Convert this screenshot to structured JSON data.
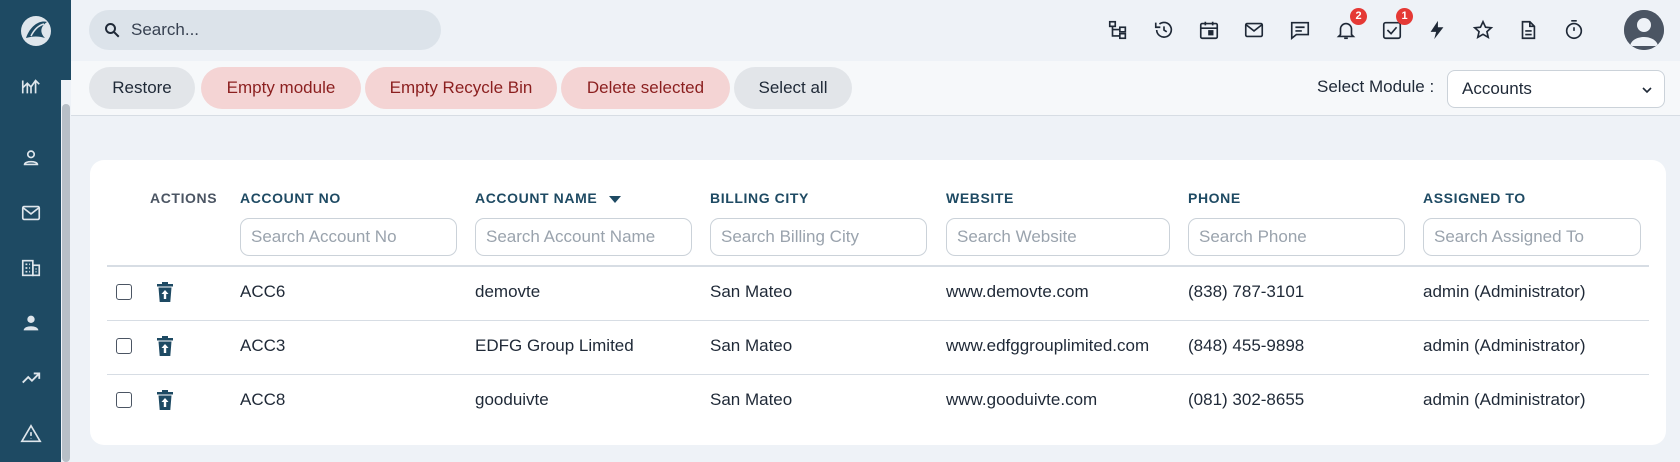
{
  "search": {
    "placeholder": "Search..."
  },
  "header": {
    "notifications_count": "2",
    "tasks_count": "1"
  },
  "toolbar": {
    "restore": "Restore",
    "empty_module": "Empty module",
    "empty_recycle_bin": "Empty Recycle Bin",
    "delete_selected": "Delete selected",
    "select_all": "Select all",
    "module_label": "Select Module :",
    "module_value": "Accounts"
  },
  "table": {
    "columns": {
      "actions": "ACTIONS",
      "account_no": "ACCOUNT NO",
      "account_name": "ACCOUNT NAME",
      "billing_city": "BILLING CITY",
      "website": "WEBSITE",
      "phone": "PHONE",
      "assigned_to": "ASSIGNED TO"
    },
    "filters": {
      "account_no": "Search Account No",
      "account_name": "Search Account Name",
      "billing_city": "Search Billing City",
      "website": "Search Website",
      "phone": "Search Phone",
      "assigned_to": "Search Assigned To"
    },
    "rows": [
      {
        "account_no": "ACC6",
        "account_name": "demovte",
        "billing_city": "San Mateo",
        "website": "www.demovte.com",
        "phone": "(838) 787-3101",
        "assigned_to": "admin (Administrator)"
      },
      {
        "account_no": "ACC3",
        "account_name": "EDFG Group Limited",
        "billing_city": "San Mateo",
        "website": "www.edfggrouplimited.com",
        "phone": "(848) 455-9898",
        "assigned_to": "admin (Administrator)"
      },
      {
        "account_no": "ACC8",
        "account_name": "gooduivte",
        "billing_city": "San Mateo",
        "website": "www.gooduivte.com",
        "phone": "(081) 302-8655",
        "assigned_to": "admin (Administrator)"
      }
    ]
  },
  "icons": {
    "sidebar": [
      "logo-icon",
      "analytics-icon",
      "contacts-icon",
      "mail-icon",
      "building-icon",
      "person-icon",
      "trend-icon",
      "warning-icon"
    ],
    "topbar": [
      "hierarchy-icon",
      "history-icon",
      "calendar-icon",
      "mail-icon",
      "chat-icon",
      "bell-icon",
      "task-check-icon",
      "bolt-icon",
      "star-icon",
      "document-icon",
      "timer-icon"
    ]
  },
  "colors": {
    "sidebar": "#1e4a63",
    "accent": "#1e4a63",
    "danger_button_bg": "#f4d4d4",
    "danger_button_text": "#8b1f1f",
    "badge": "#e53935"
  }
}
